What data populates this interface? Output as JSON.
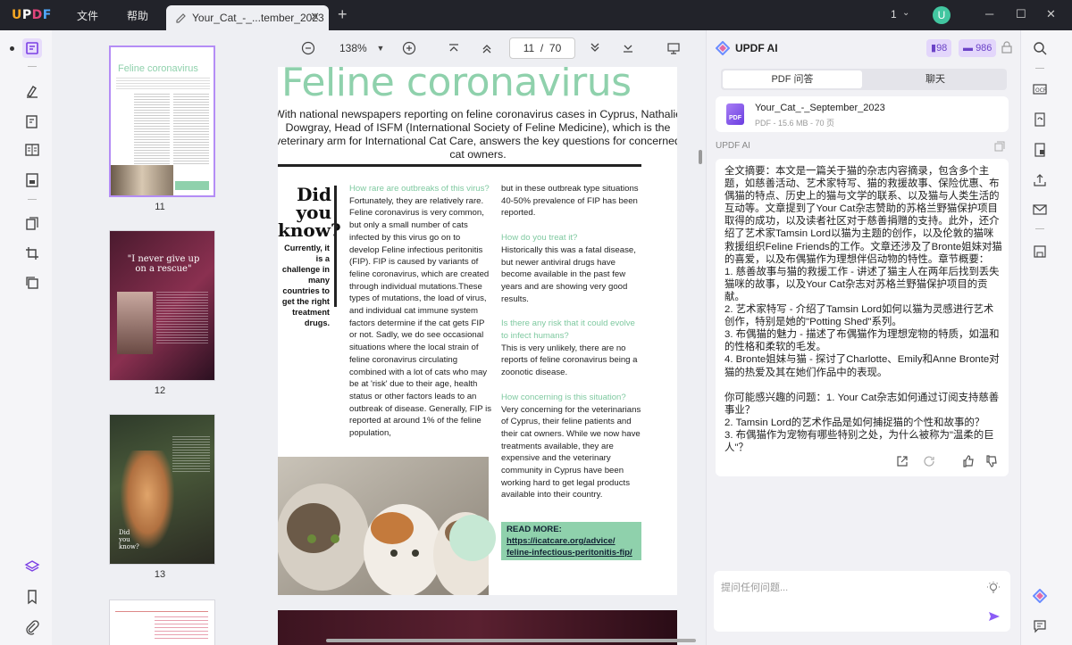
{
  "app": {
    "logo": "UPDF",
    "menu": [
      "文件",
      "帮助"
    ],
    "tab_title": "Your_Cat_-_...tember_2023",
    "window_count": "1",
    "avatar_letter": "U"
  },
  "toolbar": {
    "zoom": "138%",
    "page_current": "11",
    "page_sep": "/",
    "page_total": "70"
  },
  "thumbnails": [
    {
      "number": "11",
      "title": "Feline coronavirus"
    },
    {
      "number": "12",
      "title": "\"I never give up on a rescue\""
    },
    {
      "number": "13",
      "title": "Did you know?"
    }
  ],
  "page": {
    "title": "Feline coronavirus",
    "intro": "With national newspapers reporting on feline coronavirus cases in Cyprus, Nathalie Dowgray, Head of ISFM (International Society of Feline Medicine), which is the veterinary arm for International Cat Care, answers the key questions for concerned cat owners.",
    "did_you_know": "Did you know?",
    "did_you_know_sub": "Currently, it is a challenge in many countries to get the right treatment drugs.",
    "col1_head": "How rare are outbreaks of this virus?",
    "col1_body": "Fortunately, they are relatively rare. Feline coronavirus is very common, but only a small number of cats infected by this virus go on to develop Feline infectious peritonitis (FIP). FIP is caused by variants of feline coronavirus, which are created through individual mutations.These types of mutations, the load of virus, and individual cat immune system factors determine if the cat gets FIP or not. Sadly, we do see occasional situations where the local strain of feline coronavirus circulating combined with a lot of cats who may be at 'risk' due to their age, health status or other factors leads to an outbreak of disease. Generally, FIP is reported at around 1% of the feline population,",
    "col2_top": "but in these outbreak type situations 40-50% prevalence of FIP has been reported.",
    "col2_h1": "How do you treat it?",
    "col2_b1": "Historically this was a fatal disease, but newer antiviral drugs have become available in the past few years and are showing very good results.",
    "col2_h2": "Is there any risk that it could evolve to infect humans?",
    "col2_b2": "This is very unlikely, there are no reports of feline coronavirus being a zoonotic disease.",
    "col2_h3": "How concerning is this situation?",
    "col2_b3": "Very concerning for the veterinarians of Cyprus, their feline patients and their cat owners. While we now have treatments available, they are expensive and the veterinary community in Cyprus have been working hard to get legal products available into their country.",
    "readmore_label": "READ MORE:",
    "readmore_link": "https://icatcare.org/advice/ feline-infectious-peritonitis-fip/"
  },
  "ai": {
    "title": "UPDF AI",
    "credits_a": "98",
    "credits_b": "986",
    "tab_pdf": "PDF 问答",
    "tab_chat": "聊天",
    "file_name": "Your_Cat_-_September_2023",
    "file_meta": "PDF - 15.6 MB - 70 页",
    "section_label": "UPDF AI",
    "answer": "全文摘要：本文是一篇关于猫的杂志内容摘录，包含多个主题，如慈善活动、艺术家特写、猫的救援故事、保险优惠、布偶猫的特点、历史上的猫与文学的联系、以及猫与人类生活的互动等。文章提到了Your Cat杂志赞助的苏格兰野猫保护项目取得的成功，以及读者社区对于慈善捐赠的支持。此外，还介绍了艺术家Tamsin Lord以猫为主题的创作，以及伦敦的猫咪救援组织Feline Friends的工作。文章还涉及了Bronte姐妹对猫的喜爱，以及布偶猫作为理想伴侣动物的特性。章节概要：\n1. 慈善故事与猫的救援工作 - 讲述了猫主人在两年后找到丢失猫咪的故事，以及Your Cat杂志对苏格兰野猫保护项目的贡献。\n2. 艺术家特写 - 介绍了Tamsin Lord如何以猫为灵感进行艺术创作，特别是她的\"Potting Shed\"系列。\n3. 布偶猫的魅力 - 描述了布偶猫作为理想宠物的特质，如温和的性格和柔软的毛发。\n4. Bronte姐妹与猫 - 探讨了Charlotte、Emily和Anne Bronte对猫的热爱及其在她们作品中的表现。\n\n你可能感兴趣的问题：1. Your Cat杂志如何通过订阅支持慈善事业？\n2. Tamsin Lord的艺术作品是如何捕捉猫的个性和故事的？\n3. 布偶猫作为宠物有哪些特别之处，为什么被称为\"温柔的巨人\"？",
    "input_placeholder": "提问任何问题..."
  },
  "colors": {
    "accent": "#8b5cf6",
    "feline_green": "#8fd1ac",
    "titlebar": "#22232a"
  }
}
